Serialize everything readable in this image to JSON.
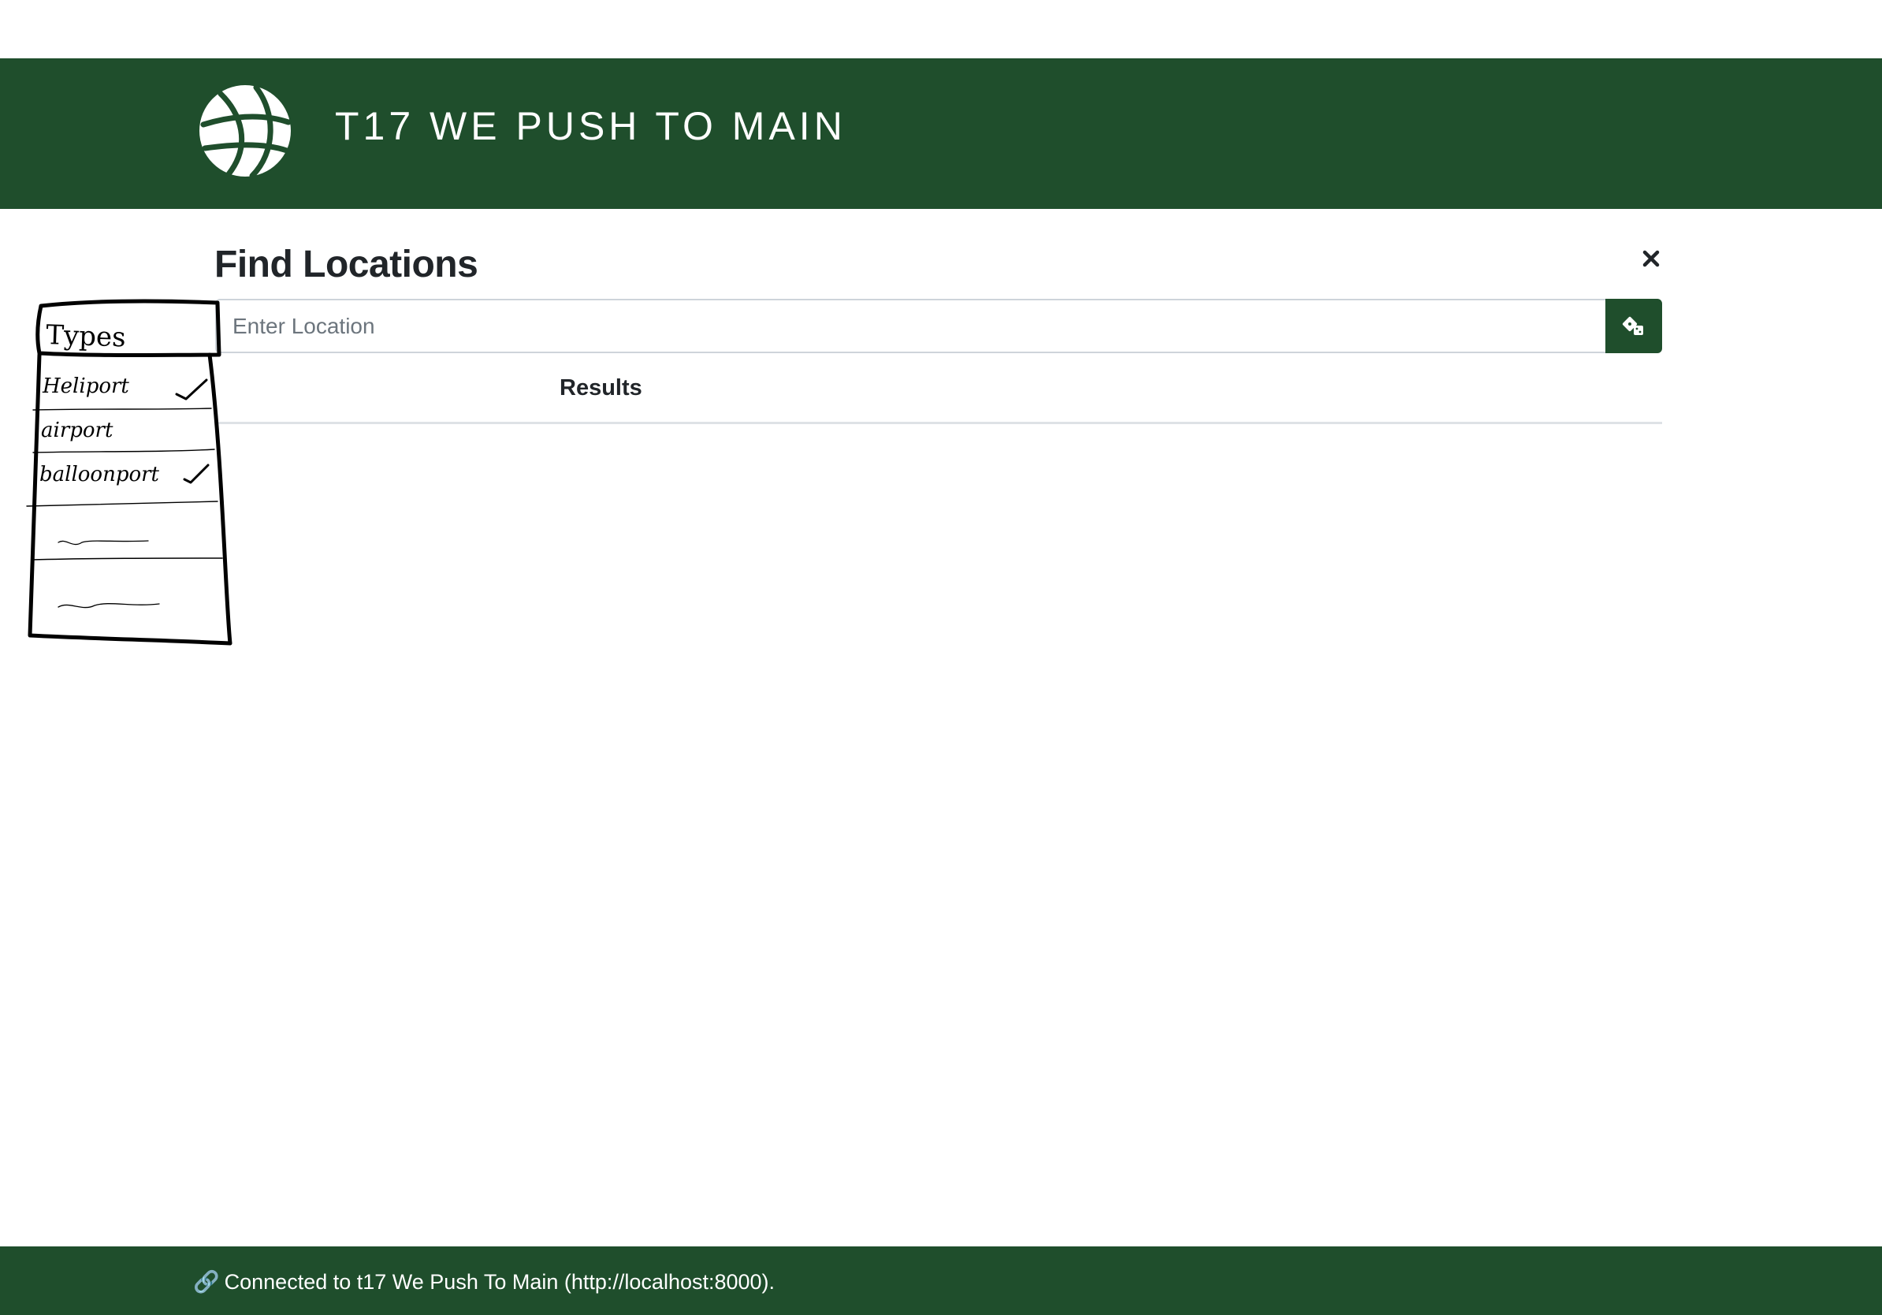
{
  "header": {
    "title": "T17 WE PUSH TO MAIN",
    "logo_icon": "globe-icon",
    "background_color": "#1f4e2c"
  },
  "find_locations": {
    "title": "Find Locations",
    "close_icon": "close-icon",
    "search": {
      "placeholder": "Enter Location",
      "value": "",
      "button_icon": "dice-icon"
    },
    "results_header": "Results"
  },
  "sketch": {
    "title": "Types",
    "items": [
      {
        "label": "Heliport",
        "checked": true
      },
      {
        "label": "airport",
        "checked": false
      },
      {
        "label": "balloonport",
        "checked": true
      }
    ]
  },
  "footer": {
    "link_icon": "link-icon",
    "text": "Connected to t17 We Push To Main  (http://localhost:8000)."
  }
}
